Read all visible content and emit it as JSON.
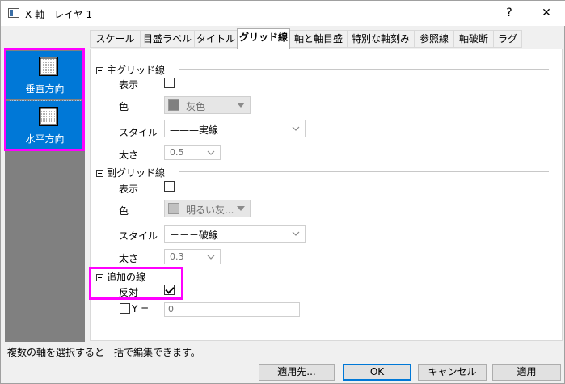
{
  "window": {
    "title": "X 軸 - レイヤ 1",
    "help": "?",
    "close": "✕"
  },
  "left_panel": {
    "items": [
      {
        "label": "垂直方向",
        "icon": "vertical-grid-icon"
      },
      {
        "label": "水平方向",
        "icon": "horizontal-grid-icon"
      }
    ]
  },
  "tabs": [
    "スケール",
    "目盛ラベル",
    "タイトル",
    "グリッド線",
    "軸と軸目盛",
    "特別な軸刻み",
    "参照線",
    "軸破断",
    "ラグ"
  ],
  "active_tab": "グリッド線",
  "major": {
    "header": "主グリッド線",
    "show_label": "表示",
    "show": false,
    "color_label": "色",
    "color_value": "灰色",
    "color_hex": "#808080",
    "style_label": "スタイル",
    "style_value": "———実線",
    "thickness_label": "太さ",
    "thickness_value": "0.5"
  },
  "minor": {
    "header": "副グリッド線",
    "show_label": "表示",
    "show": false,
    "color_label": "色",
    "color_value": "明るい灰...",
    "color_hex": "#c0c0c0",
    "style_label": "スタイル",
    "style_value": "－－－破線",
    "thickness_label": "太さ",
    "thickness_value": "0.3"
  },
  "additional": {
    "header": "追加の線",
    "opposite_label": "反対",
    "opposite": true,
    "y_label": "Y =",
    "y_value": "0"
  },
  "status": "複数の軸を選択すると一括で編集できます。",
  "buttons": {
    "apply_to": "適用先...",
    "ok": "OK",
    "cancel": "キャンセル",
    "apply": "適用"
  },
  "colors": {
    "accent": "#0078d7",
    "highlight": "#ff00ff"
  }
}
